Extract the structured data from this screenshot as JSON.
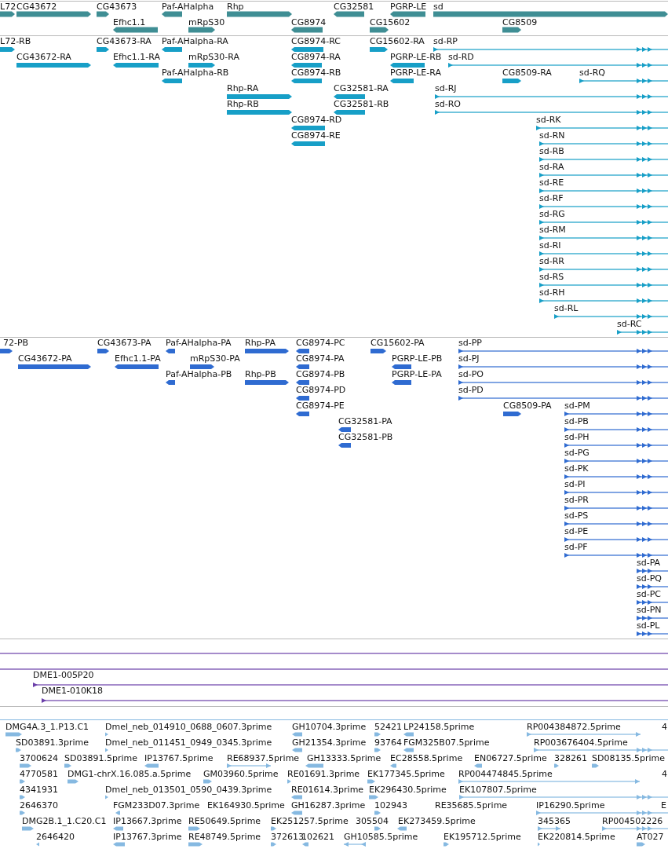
{
  "tracks": [
    {
      "kind": "genes",
      "features": [
        {
          "label": "L72",
          "reverse": false
        },
        {
          "label": "CG43672",
          "reverse": false
        },
        {
          "label": "CG43673",
          "reverse": false
        },
        {
          "label": "Paf-AHalpha",
          "reverse": true
        },
        {
          "label": "Rhp",
          "reverse": false
        },
        {
          "label": "CG32581",
          "reverse": true
        },
        {
          "label": "PGRP-LE",
          "reverse": true
        },
        {
          "label": "sd",
          "reverse": false
        },
        {
          "label": "Efhc1.1",
          "reverse": true
        },
        {
          "label": "mRpS30",
          "reverse": false
        },
        {
          "label": "CG8974",
          "reverse": true
        },
        {
          "label": "CG15602",
          "reverse": false
        },
        {
          "label": "CG8509",
          "reverse": false
        }
      ]
    },
    {
      "kind": "transcripts",
      "features": [
        {
          "label": "L72-RB",
          "reverse": false
        },
        {
          "label": "CG43673-RA",
          "reverse": false
        },
        {
          "label": "Paf-AHalpha-RA",
          "reverse": true
        },
        {
          "label": "CG8974-RC",
          "reverse": true
        },
        {
          "label": "CG15602-RA",
          "reverse": false
        },
        {
          "label": "sd-RP",
          "reverse": false
        },
        {
          "label": "CG43672-RA",
          "reverse": false
        },
        {
          "label": "Efhc1.1-RA",
          "reverse": true
        },
        {
          "label": "mRpS30-RA",
          "reverse": false
        },
        {
          "label": "CG8974-RA",
          "reverse": true
        },
        {
          "label": "PGRP-LE-RB",
          "reverse": true
        },
        {
          "label": "sd-RD",
          "reverse": false
        },
        {
          "label": "Paf-AHalpha-RB",
          "reverse": true
        },
        {
          "label": "CG8974-RB",
          "reverse": true
        },
        {
          "label": "PGRP-LE-RA",
          "reverse": true
        },
        {
          "label": "CG8509-RA",
          "reverse": false
        },
        {
          "label": "sd-RQ",
          "reverse": false
        },
        {
          "label": "Rhp-RA",
          "reverse": false
        },
        {
          "label": "CG32581-RA",
          "reverse": true
        },
        {
          "label": "sd-RJ",
          "reverse": false
        },
        {
          "label": "Rhp-RB",
          "reverse": false
        },
        {
          "label": "CG32581-RB",
          "reverse": true
        },
        {
          "label": "sd-RO",
          "reverse": false
        },
        {
          "label": "CG8974-RD",
          "reverse": true
        },
        {
          "label": "sd-RK",
          "reverse": false
        },
        {
          "label": "CG8974-RE",
          "reverse": true
        },
        {
          "label": "sd-RN",
          "reverse": false
        },
        {
          "label": "sd-RB",
          "reverse": false
        },
        {
          "label": "sd-RA",
          "reverse": false
        },
        {
          "label": "sd-RE",
          "reverse": false
        },
        {
          "label": "sd-RF",
          "reverse": false
        },
        {
          "label": "sd-RG",
          "reverse": false
        },
        {
          "label": "sd-RM",
          "reverse": false
        },
        {
          "label": "sd-RI",
          "reverse": false
        },
        {
          "label": "sd-RR",
          "reverse": false
        },
        {
          "label": "sd-RS",
          "reverse": false
        },
        {
          "label": "sd-RH",
          "reverse": false
        },
        {
          "label": "sd-RL",
          "reverse": false
        },
        {
          "label": "sd-RC",
          "reverse": false
        }
      ]
    },
    {
      "kind": "proteins",
      "features": [
        {
          "label": "72-PB",
          "reverse": false
        },
        {
          "label": "CG43673-PA",
          "reverse": false
        },
        {
          "label": "Paf-AHalpha-PA",
          "reverse": true
        },
        {
          "label": "Rhp-PA",
          "reverse": false
        },
        {
          "label": "CG8974-PC",
          "reverse": true
        },
        {
          "label": "CG15602-PA",
          "reverse": false
        },
        {
          "label": "sd-PP",
          "reverse": false
        },
        {
          "label": "CG43672-PA",
          "reverse": false
        },
        {
          "label": "Efhc1.1-PA",
          "reverse": true
        },
        {
          "label": "mRpS30-PA",
          "reverse": false
        },
        {
          "label": "CG8974-PA",
          "reverse": true
        },
        {
          "label": "PGRP-LE-PB",
          "reverse": true
        },
        {
          "label": "sd-PJ",
          "reverse": false
        },
        {
          "label": "Paf-AHalpha-PB",
          "reverse": true
        },
        {
          "label": "Rhp-PB",
          "reverse": false
        },
        {
          "label": "CG8974-PB",
          "reverse": true
        },
        {
          "label": "PGRP-LE-PA",
          "reverse": true
        },
        {
          "label": "sd-PO",
          "reverse": false
        },
        {
          "label": "CG8974-PD",
          "reverse": true
        },
        {
          "label": "sd-PD",
          "reverse": false
        },
        {
          "label": "CG8974-PE",
          "reverse": true
        },
        {
          "label": "CG8509-PA",
          "reverse": false
        },
        {
          "label": "sd-PM",
          "reverse": false
        },
        {
          "label": "CG32581-PA",
          "reverse": true
        },
        {
          "label": "sd-PB",
          "reverse": false
        },
        {
          "label": "CG32581-PB",
          "reverse": true
        },
        {
          "label": "sd-PH",
          "reverse": false
        },
        {
          "label": "sd-PG",
          "reverse": false
        },
        {
          "label": "sd-PK",
          "reverse": false
        },
        {
          "label": "sd-PI",
          "reverse": false
        },
        {
          "label": "sd-PR",
          "reverse": false
        },
        {
          "label": "sd-PS",
          "reverse": false
        },
        {
          "label": "sd-PE",
          "reverse": false
        },
        {
          "label": "sd-PF",
          "reverse": false
        },
        {
          "label": "sd-PA",
          "reverse": false
        },
        {
          "label": "sd-PQ",
          "reverse": false
        },
        {
          "label": "sd-PC",
          "reverse": false
        },
        {
          "label": "sd-PN",
          "reverse": false
        },
        {
          "label": "sd-PL",
          "reverse": false
        }
      ]
    },
    {
      "kind": "clones",
      "features": [
        {
          "kind": "line"
        },
        {
          "kind": "line"
        },
        {
          "kind": "clone",
          "label": "DME1-005P20",
          "reverse": false
        },
        {
          "kind": "clone",
          "label": "DME1-010K18",
          "reverse": false
        }
      ]
    },
    {
      "kind": "ests",
      "features": [
        {
          "label": "DMG4A.3_1.P13.C1",
          "reverse": false
        },
        {
          "label": "Dmel_neb_014910_0688_0607.3prime",
          "reverse": false
        },
        {
          "label": "GH10704.3prime",
          "reverse": true
        },
        {
          "label": "52421",
          "reverse": false
        },
        {
          "label": "LP24158.5prime",
          "reverse": true
        },
        {
          "label": "RP004384872.5prime",
          "reverse": false
        },
        {
          "label": "4"
        },
        {
          "label": "SD03891.3prime",
          "reverse": false
        },
        {
          "label": "Dmel_neb_011451_0949_0345.3prime",
          "reverse": false
        },
        {
          "label": "GH21354.3prime",
          "reverse": true
        },
        {
          "label": "93764",
          "reverse": false
        },
        {
          "label": "FGM325B07.5prime",
          "reverse": true
        },
        {
          "label": "RP003676404.5prime",
          "reverse": false
        },
        {
          "label": "3700624",
          "reverse": false
        },
        {
          "label": "SD03891.5prime",
          "reverse": false
        },
        {
          "label": "IP13767.5prime",
          "reverse": true
        },
        {
          "label": "RE68937.5prime",
          "reverse": false
        },
        {
          "label": "GH13333.5prime",
          "reverse": true
        },
        {
          "label": "EC28558.5prime",
          "reverse": true
        },
        {
          "label": "EN06727.5prime",
          "reverse": true
        },
        {
          "label": "328261",
          "reverse": false
        },
        {
          "label": "SD08135.5prime",
          "reverse": false
        },
        {
          "label": "4770581",
          "reverse": false
        },
        {
          "label": "DMG1-chrX.16.085.a.5prime",
          "reverse": false
        },
        {
          "label": "GM03960.5prime",
          "reverse": false
        },
        {
          "label": "RE01691.3prime",
          "reverse": false
        },
        {
          "label": "EK177345.5prime",
          "reverse": false
        },
        {
          "label": "RP004474845.5prime",
          "reverse": false
        },
        {
          "label": "4"
        },
        {
          "label": "4341931",
          "reverse": false
        },
        {
          "label": "Dmel_neb_013501_0590_0439.3prime",
          "reverse": false
        },
        {
          "label": "RE01614.3prime",
          "reverse": true
        },
        {
          "label": "EK296430.5prime",
          "reverse": false
        },
        {
          "label": "EK107807.5prime",
          "reverse": false
        },
        {
          "label": "2646370",
          "reverse": false
        },
        {
          "label": "FGM233D07.3prime",
          "reverse": true
        },
        {
          "label": "EK164930.5prime"
        },
        {
          "label": "GH16287.3prime",
          "reverse": true
        },
        {
          "label": "102943",
          "reverse": false
        },
        {
          "label": "RE35685.5prime"
        },
        {
          "label": "IP16290.5prime",
          "reverse": false
        },
        {
          "label": "E"
        },
        {
          "label": "DMG2B.1_1.C20.C1",
          "reverse": false
        },
        {
          "label": "IP13667.3prime",
          "reverse": true
        },
        {
          "label": "RE50649.5prime",
          "reverse": false
        },
        {
          "label": "EK251257.5prime",
          "reverse": false
        },
        {
          "label": "305504",
          "reverse": false
        },
        {
          "label": "EK273459.5prime",
          "reverse": true
        },
        {
          "label": "345365",
          "reverse": false
        },
        {
          "label": "RP004502226",
          "reverse": false
        },
        {
          "label": "2646420",
          "reverse": true
        },
        {
          "label": "IP13767.3prime",
          "reverse": true
        },
        {
          "label": "RE48749.5prime",
          "reverse": false
        },
        {
          "label": "372613",
          "reverse": false
        },
        {
          "label": "102621",
          "reverse": true
        },
        {
          "label": "GH10585.5prime",
          "reverse": true
        },
        {
          "label": "EK195712.5prime",
          "reverse": false
        },
        {
          "label": "EK220814.5prime",
          "reverse": false
        },
        {
          "label": "AT027",
          "reverse": false
        }
      ]
    }
  ]
}
